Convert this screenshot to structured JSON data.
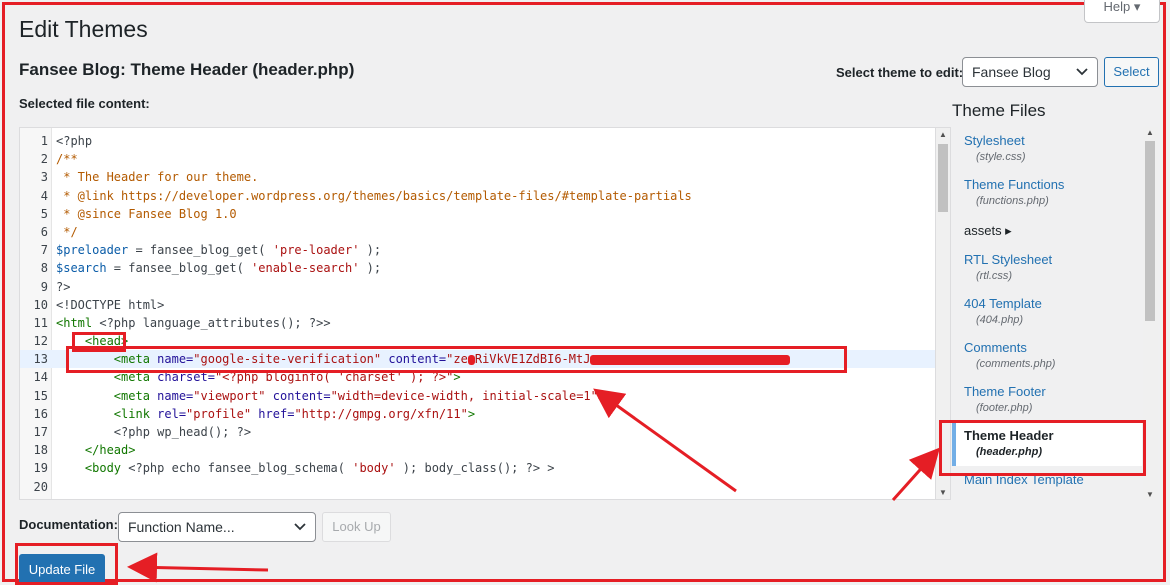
{
  "page": {
    "title": "Edit Themes",
    "help_label": "Help",
    "file_heading": "Fansee Blog: Theme Header (header.php)",
    "selected_file_label": "Selected file content:"
  },
  "theme_selector": {
    "label": "Select theme to edit:",
    "value": "Fansee Blog",
    "button": "Select"
  },
  "editor": {
    "lines": [
      {
        "n": "1"
      },
      {
        "n": "2"
      },
      {
        "n": "3"
      },
      {
        "n": "4"
      },
      {
        "n": "5"
      },
      {
        "n": "6"
      },
      {
        "n": "7"
      },
      {
        "n": "8"
      },
      {
        "n": "9"
      },
      {
        "n": "10"
      },
      {
        "n": "11"
      },
      {
        "n": "12"
      },
      {
        "n": "13"
      },
      {
        "n": "14"
      },
      {
        "n": "15"
      },
      {
        "n": "16"
      },
      {
        "n": "17"
      },
      {
        "n": "18"
      },
      {
        "n": "19"
      },
      {
        "n": "20"
      }
    ],
    "code": {
      "l1": "<?php",
      "l2": "/**",
      "l3": " * The Header for our theme.",
      "l4": " * @link https://developer.wordpress.org/themes/basics/template-files/#template-partials",
      "l5": " * @since Fansee Blog 1.0",
      "l6": " */",
      "l7_var": "$preloader",
      "l7_mid": " = fansee_blog_get( ",
      "l7_str": "'pre-loader'",
      "l7_end": " );",
      "l8_var": "$search",
      "l8_mid": " = fansee_blog_get( ",
      "l8_str": "'enable-search'",
      "l8_end": " );",
      "l9": "?>",
      "l10": "<!DOCTYPE html>",
      "l11_tag": "<html",
      "l11_rest": " <?php language_attributes(); ?>>",
      "l12_tag": "<head>",
      "l13_tag": "<meta",
      "l13_attr1": " name=",
      "l13_val1": "\"google-site-verification\"",
      "l13_attr2": " content=",
      "l13_val2a": "\"ze",
      "l13_val2b": "RiVkVE1ZdBI6-MtJ",
      "l14_tag": "<meta",
      "l14_attr": " charset=",
      "l14_val": "\"<?php bloginfo( 'charset' ); ?>\"",
      "l14_end": ">",
      "l15_tag": "<meta",
      "l15_attr1": " name=",
      "l15_val1": "\"viewport\"",
      "l15_attr2": " content=",
      "l15_val2": "\"width=device-width, initial-scale=1\"",
      "l15_end": ">",
      "l16_tag": "<link",
      "l16_attr1": " rel=",
      "l16_val1": "\"profile\"",
      "l16_attr2": " href=",
      "l16_val2": "\"http://gmpg.org/xfn/11\"",
      "l16_end": ">",
      "l17": "<?php wp_head(); ?>",
      "l18_tag": "</head>",
      "l19_tag": "<body",
      "l19_mid": " <?php echo fansee_blog_schema( ",
      "l19_str": "'body'",
      "l19_end": " ); body_class(); ?> >",
      "l20": ""
    }
  },
  "theme_files": {
    "heading": "Theme Files",
    "items": [
      {
        "name": "Stylesheet",
        "path": "(style.css)"
      },
      {
        "name": "Theme Functions",
        "path": "(functions.php)"
      },
      {
        "name": "assets ▸",
        "path": ""
      },
      {
        "name": "RTL Stylesheet",
        "path": "(rtl.css)"
      },
      {
        "name": "404 Template",
        "path": "(404.php)"
      },
      {
        "name": "Comments",
        "path": "(comments.php)"
      },
      {
        "name": "Theme Footer",
        "path": "(footer.php)"
      },
      {
        "name": "Theme Header",
        "path": "(header.php)"
      },
      {
        "name": "Main Index Template",
        "path": ""
      }
    ]
  },
  "documentation": {
    "label": "Documentation:",
    "select_value": "Function Name...",
    "lookup_button": "Look Up"
  },
  "actions": {
    "update_button": "Update File"
  },
  "colors": {
    "annotation_red": "#e51e25",
    "wp_blue": "#2271b1",
    "active_line": "#e8f2ff"
  }
}
